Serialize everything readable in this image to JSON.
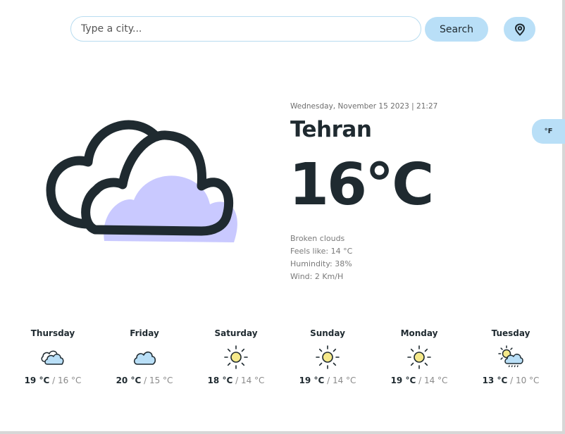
{
  "search": {
    "placeholder": "Type a city...",
    "value": "",
    "button_label": "Search"
  },
  "location_button": {
    "icon": "map-pin-icon"
  },
  "unit_toggle": {
    "label": "°F"
  },
  "current": {
    "date": "Wednesday, November 15 2023 | 21:27",
    "city": "Tehran",
    "temperature": "16°C",
    "condition": "Broken clouds",
    "feels_like": "Feels like: 14 °C",
    "humidity": "Humindity: 38%",
    "wind": "Wind: 2 Km/H",
    "icon": "broken-clouds-icon"
  },
  "forecast": [
    {
      "day": "Thursday",
      "high": "19 °C",
      "low": "16 °C",
      "icon": "clouds-icon"
    },
    {
      "day": "Friday",
      "high": "20 °C",
      "low": "15 °C",
      "icon": "cloud-icon"
    },
    {
      "day": "Saturday",
      "high": "18 °C",
      "low": "14 °C",
      "icon": "sun-icon"
    },
    {
      "day": "Sunday",
      "high": "19 °C",
      "low": "14 °C",
      "icon": "sun-icon"
    },
    {
      "day": "Monday",
      "high": "19 °C",
      "low": "14 °C",
      "icon": "sun-icon"
    },
    {
      "day": "Tuesday",
      "high": "13 °C",
      "low": "10 °C",
      "icon": "sun-cloud-rain-icon"
    }
  ],
  "colors": {
    "accent": "#b9dff7",
    "text": "#1f2a30",
    "cloud_fill": "#c9c9ff",
    "sun_fill": "#f5e98a"
  }
}
